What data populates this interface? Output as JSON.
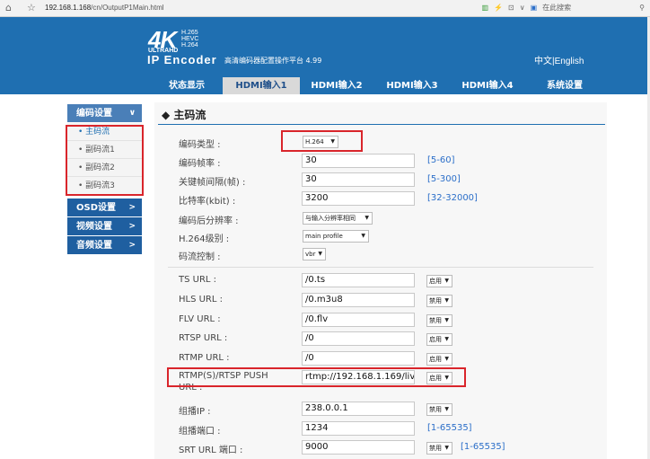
{
  "browser": {
    "url_host": "192.168.1.168",
    "url_path": "/cn/OutputP1Main.html",
    "search_label": "在此搜索"
  },
  "header": {
    "logo_main": "4K",
    "logo_codecs": "H.265\nHEVC\nH.264",
    "logo_ultra": "ULTRAHD",
    "product": "IP Encoder",
    "subtitle": "高清编码器配置操作平台 4.99",
    "lang": "中文|English"
  },
  "nav": {
    "tabs": [
      "状态显示",
      "HDMI输入1",
      "HDMI输入2",
      "HDMI输入3",
      "HDMI输入4",
      "系统设置"
    ],
    "active": 1
  },
  "sidebar": {
    "groups": [
      {
        "label": "编码设置",
        "chev": "∨",
        "items": [
          "主码流",
          "副码流1",
          "副码流2",
          "副码流3"
        ]
      },
      {
        "label": "OSD设置",
        "chev": ">"
      },
      {
        "label": "视频设置",
        "chev": ">"
      },
      {
        "label": "音频设置",
        "chev": ">"
      }
    ],
    "active_item": 0
  },
  "main": {
    "title": "◆ 主码流",
    "fields": {
      "codec_type": {
        "label": "编码类型 :",
        "value": "H.264"
      },
      "frame_rate": {
        "label": "编码帧率 :",
        "value": "30",
        "range": "[5-60]"
      },
      "gop": {
        "label": "关键帧间隔(帧) :",
        "value": "30",
        "range": "[5-300]"
      },
      "bitrate": {
        "label": "比特率(kbit) :",
        "value": "3200",
        "range": "[32-32000]"
      },
      "resolution": {
        "label": "编码后分辨率 :",
        "value": "与输入分辨率相同"
      },
      "level": {
        "label": "H.264级别 :",
        "value": "main profile"
      },
      "rate_control": {
        "label": "码流控制 :",
        "value": "vbr"
      },
      "ts_url": {
        "label": "TS URL :",
        "value": "/0.ts",
        "state": "启用"
      },
      "hls_url": {
        "label": "HLS URL :",
        "value": "/0.m3u8",
        "state": "禁用"
      },
      "flv_url": {
        "label": "FLV URL :",
        "value": "/0.flv",
        "state": "禁用"
      },
      "rtsp_url": {
        "label": "RTSP URL :",
        "value": "/0",
        "state": "启用"
      },
      "rtmp_url": {
        "label": "RTMP URL :",
        "value": "/0",
        "state": "启用"
      },
      "rtmp_push": {
        "label": "RTMP(S)/RTSP PUSH",
        "label2": "URL :",
        "value": "rtmp://192.168.1.169/live",
        "state": "启用"
      },
      "multicast_ip": {
        "label": "组播IP :",
        "value": "238.0.0.1",
        "state": "禁用"
      },
      "multicast_port": {
        "label": "组播端口 :",
        "value": "1234",
        "range": "[1-65535]"
      },
      "srt_port": {
        "label": "SRT URL 端口 :",
        "value": "9000",
        "state": "禁用",
        "range": "[1-65535]"
      }
    }
  },
  "colors": {
    "header": "#1f6fb1",
    "highlight": "#d9252b",
    "link": "#2c6fc9"
  }
}
